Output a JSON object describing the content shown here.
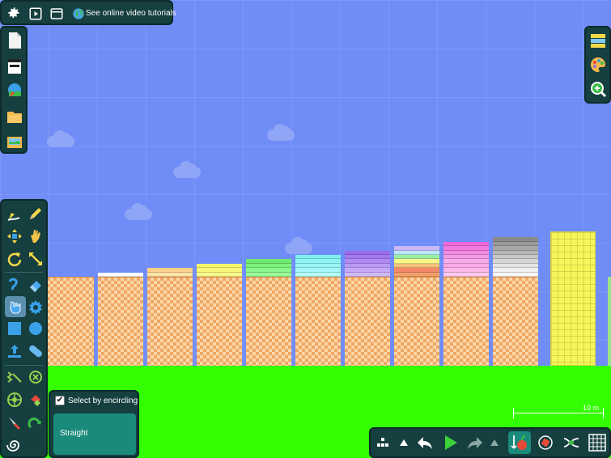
{
  "toolbar": {
    "tutorials_label": "See online video tutorials"
  },
  "select_popup": {
    "encircle_label": "Select by encircling",
    "encircle_checked": true,
    "straight_label": "Straight"
  },
  "scale": {
    "label": "10 m"
  },
  "colors": {
    "sky": "#6f8cf7",
    "ground": "#33ff00",
    "panel": "#163f3f",
    "panel_accent": "#1a8a7a",
    "brick": "#f0a865",
    "yellow_tower": "#f6f65a"
  },
  "scene": {
    "columns": [
      {
        "stripes": []
      },
      {
        "stripes": [
          "#ffffff"
        ]
      },
      {
        "stripes": [
          "#ffd08a",
          "#ffe4a8"
        ]
      },
      {
        "stripes": [
          "#f5f56a",
          "#f7f77a",
          "#f9f98a"
        ]
      },
      {
        "stripes": [
          "#6fe86f",
          "#7cf07c",
          "#8af58a",
          "#98fa98"
        ]
      },
      {
        "stripes": [
          "#7ff0f0",
          "#8cf3f3",
          "#99f6f6",
          "#a6f8f8",
          "#b3fafa"
        ]
      },
      {
        "stripes": [
          "#9a6bea",
          "#a57af0",
          "#b08af3",
          "#bb9af6",
          "#c6aaf8",
          "#d1baf9"
        ]
      },
      {
        "stripes": [
          "#c8b8f8",
          "#b9e8f8",
          "#9af0a0",
          "#f6f68a",
          "#f5c07a",
          "#f58a6a",
          "#f2a06a"
        ]
      },
      {
        "stripes": [
          "#f06ad8",
          "#f27ade",
          "#f48ae2",
          "#f69ae6",
          "#f8aaea",
          "#faa8e6",
          "#fbb8ea",
          "#fcc8ee"
        ]
      },
      {
        "stripes": [
          "#8a8a8a",
          "#999999",
          "#a8a8a8",
          "#b7b7b7",
          "#c6c6c6",
          "#d5d5d5",
          "#e4e4e4",
          "#f0f0f0",
          "#f8f8f8"
        ]
      }
    ]
  },
  "icons": {
    "top": [
      "gear-icon",
      "play-window-icon",
      "window-icon",
      "globe-icon"
    ],
    "left_top": [
      "new-document-icon",
      "archive-icon",
      "import-icon",
      "folder-icon",
      "landscape-folder-icon"
    ],
    "left_tools": [
      "draw-icon",
      "pencil-icon",
      "move-icon",
      "grab-hand-icon",
      "rotate-icon",
      "scale-icon",
      "rope-icon",
      "eraser-icon",
      "select-icon",
      "gear-shape-icon",
      "rectangle-icon",
      "circle-icon",
      "upload-icon",
      "capsule-icon",
      "spring-icon",
      "cancel-icon",
      "wheel-icon",
      "magnet-icon",
      "knife-icon",
      "hook-icon",
      "spiral-icon"
    ],
    "right": [
      "layers-icon",
      "palette-icon",
      "zoom-settings-icon"
    ],
    "bottom": [
      "nodes-icon",
      "triangle-up-icon",
      "undo-icon",
      "play-icon",
      "redo-icon",
      "triangle-up-icon",
      "gravity-icon",
      "rotate-object-icon",
      "path-icon",
      "grid-icon"
    ]
  }
}
